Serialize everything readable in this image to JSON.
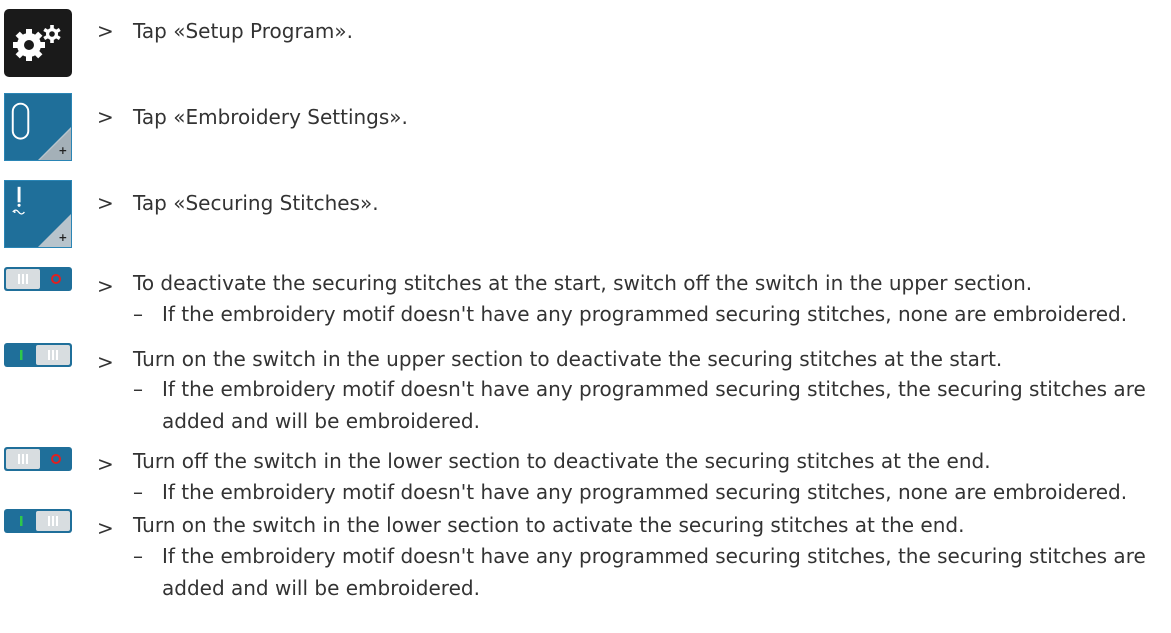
{
  "steps": [
    {
      "text": "Tap «Setup Program».",
      "icon": "setup-program-icon"
    },
    {
      "text": "Tap «Embroidery Settings».",
      "icon": "embroidery-settings-icon"
    },
    {
      "text": "Tap «Securing Stitches».",
      "icon": "securing-stitches-icon"
    },
    {
      "text": "To deactivate the securing stitches at the start, switch off the switch in the upper section.",
      "sub": "If the embroidery motif doesn't have any programmed securing stitches, none are embroidered.",
      "icon": "toggle-off-icon"
    },
    {
      "text": "Turn on the switch in the upper section to deactivate the securing stitches at the start.",
      "sub": "If the embroidery motif doesn't have any programmed securing stitches, the securing stitches are added and will be embroidered.",
      "icon": "toggle-on-icon"
    },
    {
      "text": "Turn off the switch in the lower section to deactivate the securing stitches at the end.",
      "sub": "If the embroidery motif doesn't have any programmed securing stitches, none are embroidered.",
      "icon": "toggle-off-icon"
    },
    {
      "text": "Turn on the switch in the lower section to activate the securing stitches at the end.",
      "sub": "If the embroidery motif doesn't have any programmed securing stitches, the securing stitches are added and will be embroidered.",
      "icon": "toggle-on-icon"
    }
  ],
  "symbols": {
    "step_marker": ">",
    "sub_marker": "–"
  },
  "colors": {
    "text": "#333333",
    "button_blue": "#1f6f9a",
    "button_dark": "#1a1a1a",
    "toggle_on_green": "#2e9e3a",
    "toggle_off_red": "#e02020"
  }
}
